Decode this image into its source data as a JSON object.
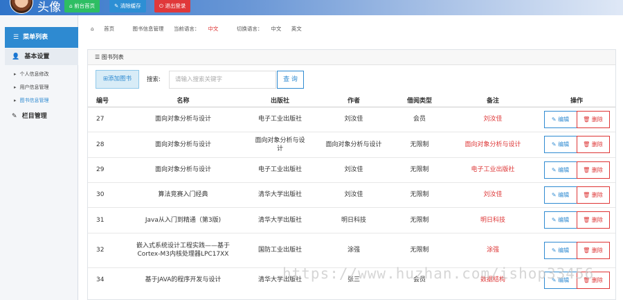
{
  "header": {
    "avatar_title": "头像",
    "buttons": [
      {
        "label": "前台首页",
        "icon": "home-icon"
      },
      {
        "label": "清除缓存",
        "icon": "wrench-icon"
      },
      {
        "label": "退出登录",
        "icon": "power-icon"
      }
    ]
  },
  "sidebar": {
    "heading": "菜单列表",
    "groups": [
      {
        "label": "基本设置",
        "icon": "user-icon",
        "items": [
          "个人信息修改",
          "用户信息管理",
          "图书信息管理"
        ]
      },
      {
        "label": "栏目管理",
        "icon": "edit-icon",
        "items": []
      }
    ],
    "active_item": "图书信息管理"
  },
  "breadcrumb": {
    "home": "首页",
    "current": "图书信息管理",
    "lang_label": "当前语言：",
    "lang_value": "中文",
    "switch_label": "切换语言：",
    "switch_cn": "中文",
    "switch_en": "英文"
  },
  "panel": {
    "title": "图书列表",
    "add_button": "添加图书",
    "search_label": "搜索:",
    "search_placeholder": "请输入搜索关键字",
    "search_button": "查 询"
  },
  "table": {
    "headers": [
      "编号",
      "名称",
      "出版社",
      "作者",
      "借阅类型",
      "备注",
      "操作"
    ],
    "edit_label": "编辑",
    "delete_label": "删除",
    "rows": [
      {
        "id": "27",
        "name": "面向对象分析与设计",
        "publisher": "电子工业出版社",
        "author": "刘汝佳",
        "type": "会员",
        "note": "刘汝佳"
      },
      {
        "id": "28",
        "name": "面向对象分析与设计",
        "publisher": "面向对象分析与设计",
        "author": "面向对象分析与设计",
        "type": "无限制",
        "note": "面向对象分析与设计"
      },
      {
        "id": "29",
        "name": "面向对象分析与设计",
        "publisher": "电子工业出版社",
        "author": "刘汝佳",
        "type": "无限制",
        "note": "电子工业出版社"
      },
      {
        "id": "30",
        "name": "算法竞赛入门经典",
        "publisher": "清华大学出版社",
        "author": "刘汝佳",
        "type": "无限制",
        "note": "刘汝佳"
      },
      {
        "id": "31",
        "name": "Java从入门到精通（第3版)",
        "publisher": "清华大学出版社",
        "author": "明日科技",
        "type": "无限制",
        "note": "明日科技"
      },
      {
        "id": "32",
        "name": "嵌入式系统设计工程实践——基于Cortex-M3内核处理器LPC17XX",
        "publisher": "国防工业出版社",
        "author": "涂强",
        "type": "无限制",
        "note": "涂强"
      },
      {
        "id": "34",
        "name": "基于JAVA的程序开发与设计",
        "publisher": "清华大学出版社",
        "author": "张三",
        "type": "会员",
        "note": "数据结构"
      }
    ]
  },
  "watermark": "https://www.huzhan.com/ishop33456",
  "colors": {
    "primary": "#2e8ad1",
    "danger": "#d33",
    "success": "#2ebe63"
  }
}
